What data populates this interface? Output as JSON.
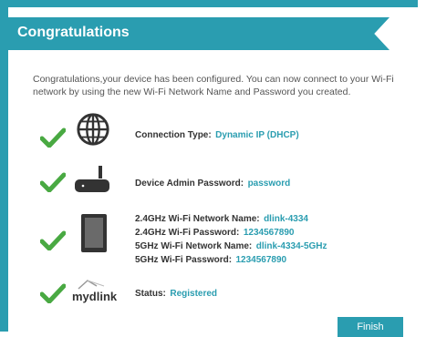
{
  "title": "Congratulations",
  "intro": "Congratulations,your device has been configured. You can now connect to your Wi-Fi network by using the new Wi-Fi Network Name and Password you created.",
  "rows": {
    "connection": {
      "label": "Connection Type:",
      "value": "Dynamic IP (DHCP)"
    },
    "admin": {
      "label": "Device Admin Password:",
      "value": "password"
    },
    "wifi": [
      {
        "label": "2.4GHz Wi-Fi Network Name:",
        "value": "dlink-4334"
      },
      {
        "label": "2.4GHz Wi-Fi Password:",
        "value": "1234567890"
      },
      {
        "label": "5GHz Wi-Fi Network Name:",
        "value": "dlink-4334-5GHz"
      },
      {
        "label": "5GHz Wi-Fi Password:",
        "value": "1234567890"
      }
    ],
    "mydlink": {
      "logo_text": "mydlink",
      "label": "Status:",
      "value": "Registered"
    }
  },
  "finish_label": "Finish",
  "colors": {
    "accent": "#2a9db0",
    "check": "#49a942"
  },
  "icons": [
    "check-icon",
    "globe-icon",
    "router-icon",
    "tablet-icon",
    "mydlink-logo"
  ]
}
